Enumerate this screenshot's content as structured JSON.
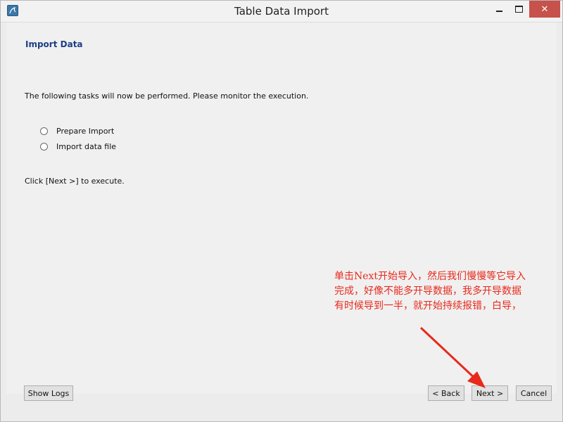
{
  "window": {
    "title": "Table Data Import"
  },
  "page": {
    "heading": "Import Data",
    "description": "The following tasks will now be performed. Please monitor the execution.",
    "tasks": [
      {
        "label": "Prepare Import"
      },
      {
        "label": "Import data file"
      }
    ],
    "hint": "Click [Next >] to execute."
  },
  "annotation": {
    "lines": [
      "单击Next开始导入，然后我们慢慢等它导入",
      "完成，好像不能多开导数据，我多开导数据",
      "有时候导到一半，就开始持续报错，白导，"
    ],
    "color": "#e8291c"
  },
  "buttons": {
    "show_logs": "Show Logs",
    "back": "< Back",
    "next": "Next >",
    "cancel": "Cancel"
  },
  "colors": {
    "heading": "#1e3e84",
    "close_button": "#c7514b"
  }
}
